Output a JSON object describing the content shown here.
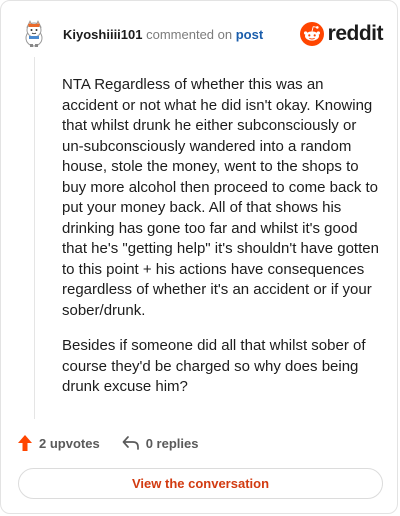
{
  "comment": {
    "username": "Kiyoshiiii101",
    "action_text": "commented on",
    "post_link": "post",
    "paragraphs": [
      "NTA Regardless of whether this was an accident or not what he did isn't okay. Knowing that whilst drunk he either subconsciously or un-subconsciously wandered into a random house, stole the money, went to the shops to buy more alcohol then proceed to come back to put your money back. All of that shows his drinking has gone too far and whilst it's good that he's \"getting help\" it's shouldn't have gotten to this point + his actions have consequences regardless of whether it's an accident or if your sober/drunk.",
      "Besides if someone did all that whilst sober of course they'd be charged so why does being drunk excuse him?"
    ],
    "upvotes_label": "2 upvotes",
    "replies_label": "0 replies"
  },
  "brand": {
    "wordmark": "reddit",
    "color": "#ff4500"
  },
  "footer": {
    "view_conversation_label": "View the conversation"
  },
  "icons": [
    "avatar",
    "reddit-logo-icon",
    "upvote-arrow-icon",
    "reply-arrow-icon"
  ]
}
